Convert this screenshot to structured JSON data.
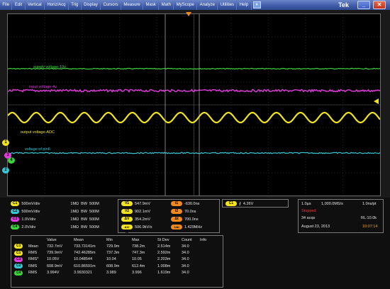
{
  "menu": {
    "items": [
      "File",
      "Edit",
      "Vertical",
      "Horiz/Acq",
      "Trig",
      "Display",
      "Cursors",
      "Measure",
      "Mask",
      "Math",
      "MyScope",
      "Analyze",
      "Utilities",
      "Help"
    ],
    "help_dropdown": "▾",
    "brand": "Tek",
    "minimize": "_",
    "close": "✕"
  },
  "colors": {
    "ch1": "#f2e41c",
    "ch2": "#37c7d4",
    "ch3": "#e43ce0",
    "ch4": "#3bd43b",
    "orange": "#f08a1c"
  },
  "traces": {
    "supply": "supply voltage-10v",
    "input": "input voltage-4v",
    "output": "output voltage-ADC",
    "pin6": "voltage of pin6"
  },
  "markers": {
    "ch1": "1",
    "ch2": "2",
    "ch3": "3",
    "ch4": "4",
    "trigger_t": "T"
  },
  "channels": [
    {
      "label": "C1",
      "scale": "500mV/div",
      "impedance": "1MΩ",
      "bw": "BW",
      "bw_value": "500M"
    },
    {
      "label": "C2",
      "scale": "500mV/div",
      "impedance": "1MΩ",
      "bw": "BW",
      "bw_value": "500M"
    },
    {
      "label": "C3",
      "scale": "1.0V/div",
      "impedance": "1MΩ",
      "bw": "BW",
      "bw_value": "500M"
    },
    {
      "label": "C4",
      "scale": "2.0V/div",
      "impedance": "1MΩ",
      "bw": "BW",
      "bw_value": "500M"
    }
  ],
  "cursors": {
    "v1_label": "V1",
    "v1": "547.9mV",
    "v2_label": "V2",
    "v2": "902.1mV",
    "dv_label": "ΔV",
    "dv": "354.2mV",
    "dvdt_label": "ΔV/Δt",
    "dvdt": "506.9kV/s",
    "t1_label": "t1",
    "t1": "-630.0ns",
    "t2_label": "t2",
    "t2": "70.0ns",
    "dt_label": "Δt",
    "dt": "700.0ns",
    "freq_label": "1/Δt",
    "freq": "1.429MHz"
  },
  "trigger": {
    "channel": "C1",
    "slope": "⨍",
    "level": "4.26V"
  },
  "acquisition": {
    "timebase": "1.0µs",
    "sample_rate": "1,000.0MS/s",
    "resolution": "1.0ns/pt",
    "state": "Stopped",
    "acqs": "34 acqs",
    "record_length": "RL:10.0k",
    "date": "August 23, 2013",
    "time": "10:07:14"
  },
  "measurements": {
    "headers": [
      "",
      "",
      "Value",
      "Mean",
      "Min",
      "Max",
      "St Dev",
      "Count",
      "Info"
    ],
    "rows": [
      {
        "ch": "C1",
        "name": "Mean",
        "value": "732.7mV",
        "mean": "733.73141m",
        "min": "729.9m",
        "max": "738.2m",
        "stdev": "2.514m",
        "count": "34.0",
        "info": ""
      },
      {
        "ch": "C1",
        "name": "RMS",
        "value": "739.9mV",
        "mean": "742.46285m",
        "min": "737.3m",
        "max": "747.3m",
        "stdev": "2.592m",
        "count": "34.0",
        "info": ""
      },
      {
        "ch": "C3",
        "name": "RMS*",
        "value": "10.05V",
        "mean": "10.048544",
        "min": "10.04",
        "max": "10.05",
        "stdev": "2.203m",
        "count": "34.0",
        "info": ""
      },
      {
        "ch": "C2",
        "name": "RMS",
        "value": "608.9mV",
        "mean": "610.86591m",
        "min": "608.9m",
        "max": "612.4m",
        "stdev": "1.008m",
        "count": "34.0",
        "info": ""
      },
      {
        "ch": "C4",
        "name": "RMS",
        "value": "3.994V",
        "mean": "3.9930321",
        "min": "3.989",
        "max": "3.996",
        "stdev": "1.619m",
        "count": "34.0",
        "info": ""
      }
    ]
  }
}
